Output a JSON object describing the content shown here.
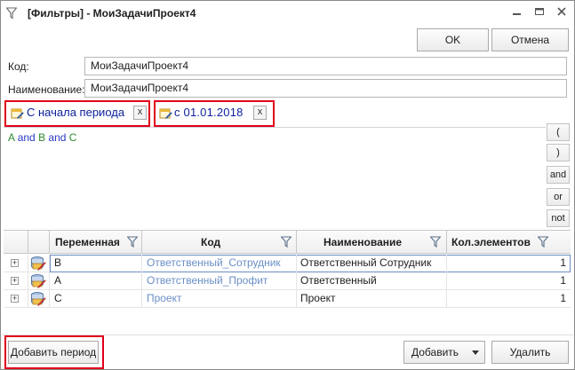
{
  "window": {
    "title": "[Фильтры] - МоиЗадачиПроект4"
  },
  "toolbar": {
    "ok_label": "OK",
    "cancel_label": "Отмена"
  },
  "fields": {
    "code_label": "Код:",
    "code_value": "МоиЗадачиПроект4",
    "name_label": "Наименование:",
    "name_value": "МоиЗадачиПроект4"
  },
  "periods": [
    {
      "label": "С начала периода",
      "close": "x"
    },
    {
      "label": "с 01.01.2018",
      "close": "x"
    }
  ],
  "formula": {
    "parts": [
      "A",
      "and",
      "B",
      "and",
      "C"
    ]
  },
  "operators": [
    "(",
    ")",
    "and",
    "or",
    "not"
  ],
  "grid": {
    "columns": [
      "Переменная",
      "Код",
      "Наименование",
      "Кол.элементов"
    ],
    "rows": [
      {
        "var": "B",
        "code": "Ответственный_Сотрудник",
        "name": "Ответственный Сотрудник",
        "count": "1"
      },
      {
        "var": "A",
        "code": "Ответственный_Профит",
        "name": "Ответственный",
        "count": "1"
      },
      {
        "var": "C",
        "code": "Проект",
        "name": "Проект",
        "count": "1"
      }
    ]
  },
  "footer": {
    "add_period_label": "Добавить период",
    "add_label": "Добавить",
    "delete_label": "Удалить"
  },
  "icons": {
    "title": "filter-icon",
    "chip": "calendar-edit-icon",
    "row": "database-edit-icon"
  },
  "colors": {
    "highlight_frame": "#e0001a",
    "chip_text": "#0a1f9c",
    "link": "#6a8fc7",
    "formula_var": "#2e8b2e",
    "formula_op": "#2b39c7",
    "row_selection": "#6c8ebf"
  }
}
